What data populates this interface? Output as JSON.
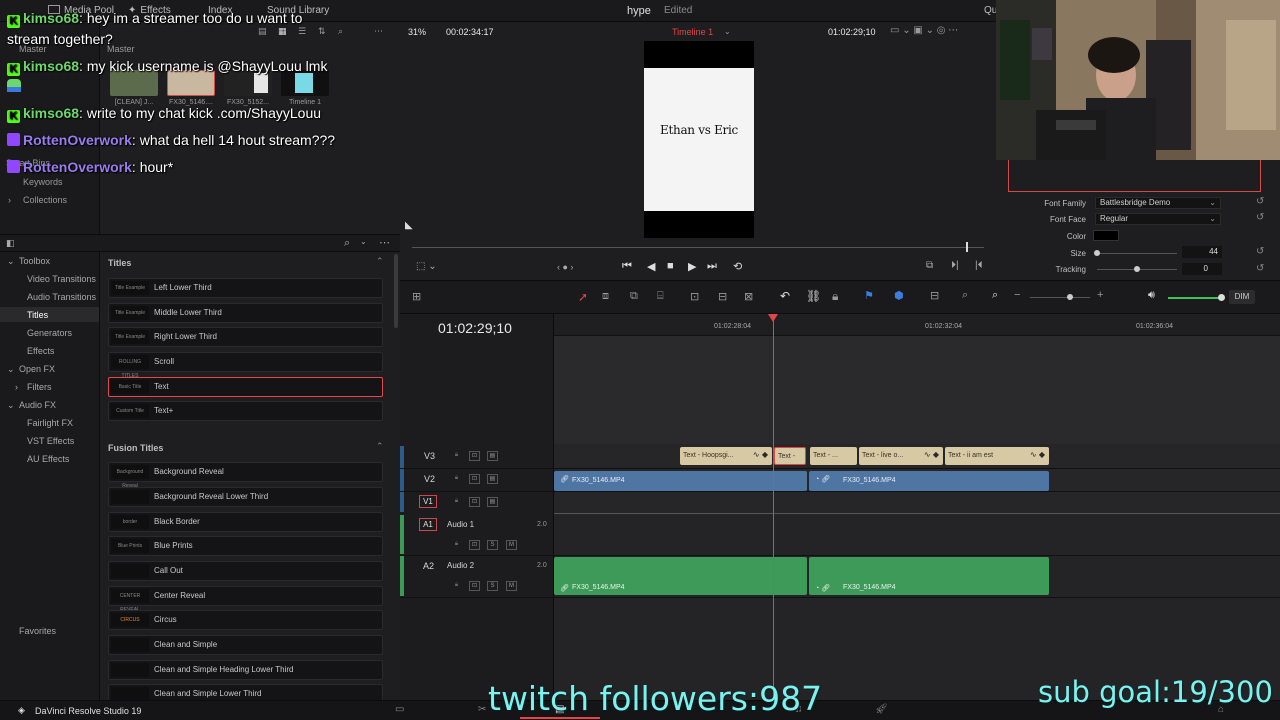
{
  "app": {
    "project_title": "hype",
    "project_status": "Edited",
    "product_name": "DaVinci Resolve Studio 19"
  },
  "topbar": {
    "media_pool": "Media Pool",
    "effects": "Effects",
    "index": "Index",
    "sound_library": "Sound Library",
    "quick": "Qu"
  },
  "media_pool": {
    "master_label": "Master",
    "master_label2": "Master",
    "clips": [
      {
        "name": "[CLEAN] J..."
      },
      {
        "name": "FX30_5146...."
      },
      {
        "name": "FX30_5152..."
      },
      {
        "name": "Timeline 1"
      }
    ],
    "smart_bins": "Smart Bins",
    "keywords": "Keywords",
    "collections": "Collections"
  },
  "toolbox": {
    "items": [
      "Toolbox",
      "Video Transitions",
      "Audio Transitions",
      "Titles",
      "Generators",
      "Effects",
      "Open FX",
      "Filters",
      "Audio FX",
      "Fairlight FX",
      "VST Effects",
      "AU Effects"
    ],
    "favorites": "Favorites"
  },
  "titles_panel": {
    "header": "Titles",
    "titles": [
      {
        "label": "Left Lower Third",
        "thumb": "Title Example"
      },
      {
        "label": "Middle Lower Third",
        "thumb": "Title Example"
      },
      {
        "label": "Right Lower Third",
        "thumb": "Title Example"
      },
      {
        "label": "Scroll",
        "thumb": "ROLLING TITLES"
      },
      {
        "label": "Text",
        "thumb": "Basic Title"
      },
      {
        "label": "Text+",
        "thumb": "Custom Title"
      }
    ],
    "fusion_header": "Fusion Titles",
    "fusion_titles": [
      {
        "label": "Background Reveal",
        "thumb": "Background Reveal"
      },
      {
        "label": "Background Reveal Lower Third",
        "thumb": ""
      },
      {
        "label": "Black Border",
        "thumb": "border"
      },
      {
        "label": "Blue Prints",
        "thumb": "Blue Prints"
      },
      {
        "label": "Call Out",
        "thumb": ""
      },
      {
        "label": "Center Reveal",
        "thumb": "CENTER REVEAL"
      },
      {
        "label": "Circus",
        "thumb": "CIRCUS"
      },
      {
        "label": "Clean and Simple",
        "thumb": ""
      },
      {
        "label": "Clean and Simple Heading Lower Third",
        "thumb": ""
      },
      {
        "label": "Clean and Simple Lower Third",
        "thumb": ""
      }
    ]
  },
  "viewer": {
    "zoom": "31%",
    "source_timecode": "00:02:34:17",
    "timeline_name": "Timeline 1",
    "record_timecode": "01:02:29;10",
    "frame_text": "Ethan vs Eric"
  },
  "inspector": {
    "font_family_label": "Font Family",
    "font_family_value": "Battlesbridge Demo",
    "font_face_label": "Font Face",
    "font_face_value": "Regular",
    "color_label": "Color",
    "size_label": "Size",
    "size_value": "44",
    "tracking_label": "Tracking",
    "tracking_value": "0",
    "size_slider_fraction": 0.0,
    "tracking_slider_fraction": 0.5
  },
  "timeline": {
    "timecode": "01:02:29;10",
    "ruler": [
      "01:02:28:04",
      "01:02:32:04",
      "01:02:36:04"
    ],
    "dim_label": "DIM",
    "tracks": [
      {
        "id": "V3",
        "name": ""
      },
      {
        "id": "V2",
        "name": ""
      },
      {
        "id": "V1",
        "name": ""
      },
      {
        "id": "A1",
        "name": "Audio 1",
        "level": "2.0"
      },
      {
        "id": "A2",
        "name": "Audio 2",
        "level": "2.0"
      }
    ],
    "title_clips": [
      "Text - Hoopsgi...",
      "Text -",
      "Text - ...",
      "Text - live o...",
      "Text - ii am est"
    ],
    "video_clips": [
      "FX30_5146.MP4",
      "FX30_5146.MP4"
    ],
    "audio_clips": [
      "FX30_5146.MP4",
      "FX30_5146.MP4"
    ],
    "solo": "S",
    "mute": "M"
  },
  "chat": [
    {
      "platform": "kick",
      "user": "kimso68",
      "message": "hey im a streamer too do u want to"
    },
    {
      "platform": "none",
      "user": "",
      "message": "stream together?"
    },
    {
      "platform": "kick",
      "user": "kimso68",
      "message": "my kick username is @ShayyLouu lmk"
    },
    {
      "platform": "kick",
      "user": "kimso68",
      "message": "write to my chat kick .com/ShayyLouu"
    },
    {
      "platform": "twitch",
      "user": "RottenOverwork",
      "message": "what da hell 14 hout stream???"
    },
    {
      "platform": "twitch",
      "user": "RottenOverwork",
      "message": "hour*"
    }
  ],
  "stream_overlay": {
    "followers": "twitch followers:987",
    "sub_goal": "sub goal:19/300"
  },
  "colors": {
    "playhead": "#e24545",
    "title_clip": "#d7c9a4",
    "video_clip": "#4f75a3",
    "audio_clip": "#3e9a59",
    "overlay_text": "#7af2f0"
  }
}
